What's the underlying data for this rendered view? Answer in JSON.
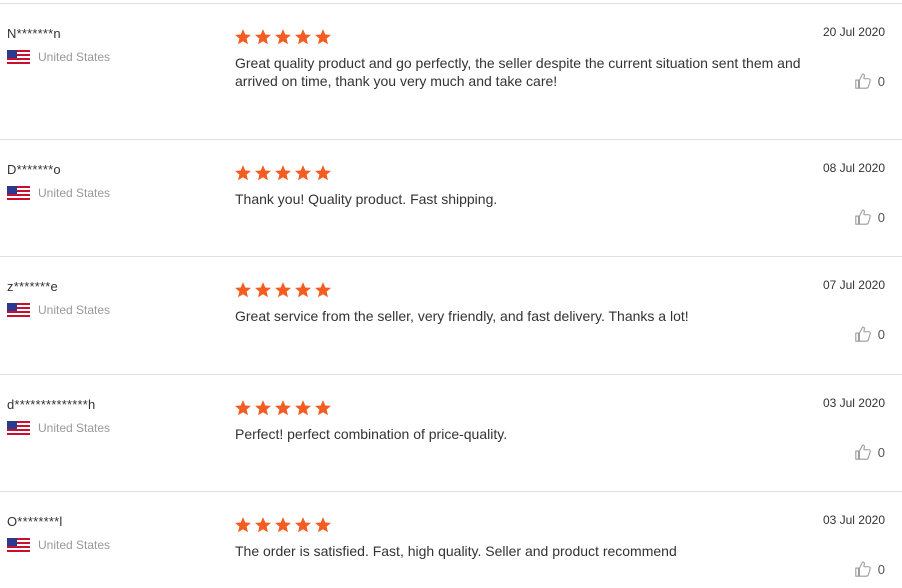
{
  "colors": {
    "star": "#f45c21",
    "divider": "#e0e0e0",
    "country": "#999999"
  },
  "icons": {
    "rating": "star-icon",
    "flag": "us-flag-icon",
    "helpful": "thumbs-up-icon"
  },
  "reviews": [
    {
      "user": "N*******n",
      "country": "United States",
      "rating": 5,
      "text": "Great quality product and go perfectly, the seller despite the current situation sent them and arrived on time, thank you very much and take care!",
      "date": "20 Jul 2020",
      "helpful": "0"
    },
    {
      "user": "D*******o",
      "country": "United States",
      "rating": 5,
      "text": "Thank you! Quality product. Fast shipping.",
      "date": "08 Jul 2020",
      "helpful": "0"
    },
    {
      "user": "z*******e",
      "country": "United States",
      "rating": 5,
      "text": "Great service from the seller, very friendly, and fast delivery. Thanks a lot!",
      "date": "07 Jul 2020",
      "helpful": "0"
    },
    {
      "user": "d**************h",
      "country": "United States",
      "rating": 5,
      "text": "Perfect! perfect combination of price-quality.",
      "date": "03 Jul 2020",
      "helpful": "0"
    },
    {
      "user": "O********l",
      "country": "United States",
      "rating": 5,
      "text": "The order is satisfied. Fast, high quality. Seller and product recommend",
      "date": "03 Jul 2020",
      "helpful": "0"
    }
  ]
}
